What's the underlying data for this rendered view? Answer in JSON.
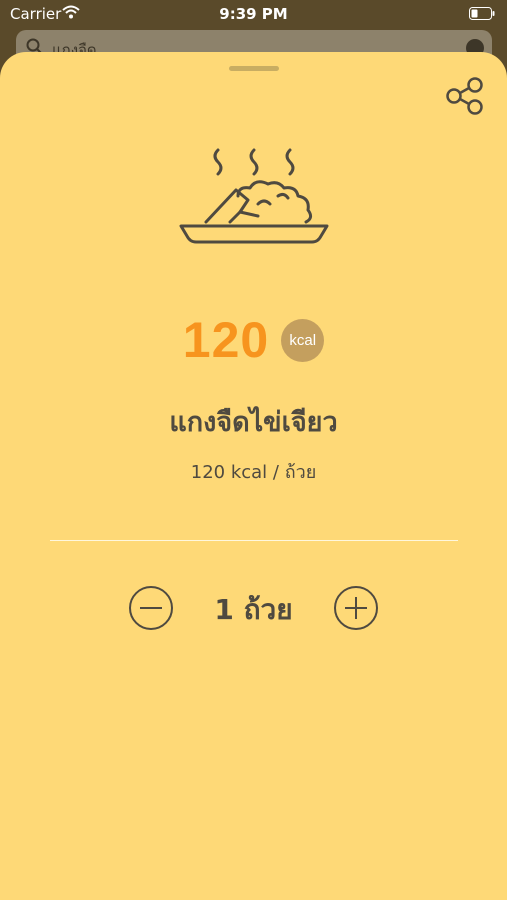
{
  "status_bar": {
    "carrier": "Carrier",
    "time": "9:39 PM",
    "icons": [
      "wifi-icon",
      "battery-icon"
    ]
  },
  "search": {
    "query": "แกงจืด",
    "icons": [
      "search-icon",
      "clear-icon"
    ]
  },
  "detail": {
    "share_icon": "share-icon",
    "food_icon": "food-plate-icon",
    "calories": "120",
    "calorie_unit": "kcal",
    "food_name": "แกงจืดไข่เจียว",
    "serving_info": "120 kcal / ถ้วย",
    "quantity": "1 ถ้วย",
    "decrement_icon": "minus-icon",
    "increment_icon": "plus-icon"
  },
  "colors": {
    "sheet_bg": "#fed977",
    "accent": "#f7941e",
    "badge": "#c49f5e",
    "text": "#4f4a40"
  }
}
